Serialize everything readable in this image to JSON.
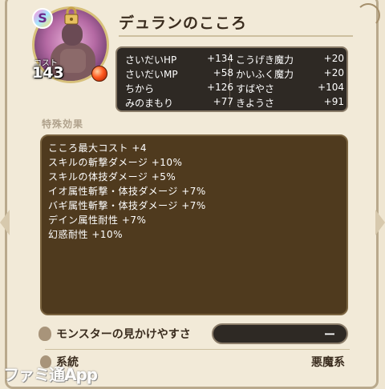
{
  "header": {
    "rank": "S",
    "title": "デュランのこころ",
    "cost_label": "コスト",
    "cost_value": "143"
  },
  "stats": [
    {
      "name": "さいだいHP",
      "value": "+134"
    },
    {
      "name": "さいだいMP",
      "value": "+58"
    },
    {
      "name": "ちから",
      "value": "+126"
    },
    {
      "name": "みのまもり",
      "value": "+77"
    },
    {
      "name": "こうげき魔力",
      "value": "+20"
    },
    {
      "name": "かいふく魔力",
      "value": "+20"
    },
    {
      "name": "すばやさ",
      "value": "+104"
    },
    {
      "name": "きようさ",
      "value": "+91"
    }
  ],
  "effects": {
    "label": "特殊効果",
    "lines": [
      "こころ最大コスト +4",
      "スキルの斬撃ダメージ +10%",
      "スキルの体技ダメージ +5%",
      "イオ属性斬撃・体技ダメージ +7%",
      "バギ属性斬撃・体技ダメージ +7%",
      "デイン属性耐性 +7%",
      "幻惑耐性 +10%"
    ]
  },
  "visibility": {
    "label": "モンスターの見かけやすさ",
    "value": "ー"
  },
  "category": {
    "label": "系統",
    "value": "悪魔系"
  },
  "watermark": "ファミ通App",
  "colors": {
    "panel_bg": "#efe6d2",
    "stats_bg": "#2e2924",
    "effects_bg": "#4f3a1e"
  }
}
